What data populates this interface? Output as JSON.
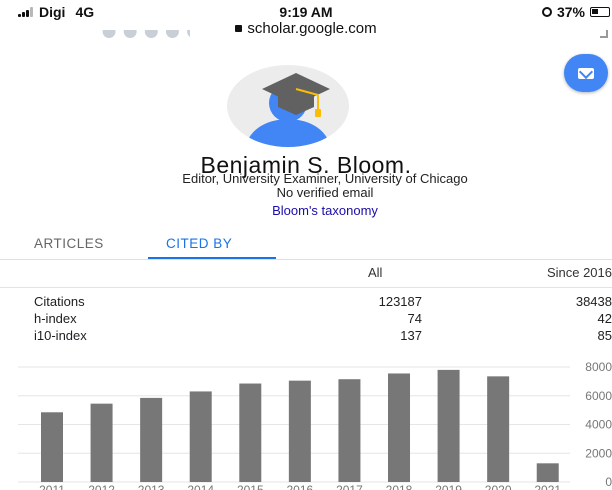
{
  "status_bar": {
    "carrier": "Digi",
    "network": "4G",
    "time": "9:19 AM",
    "url": "scholar.google.com",
    "battery": "37%"
  },
  "profile": {
    "name": "Benjamin S. Bloom.",
    "affiliation": "Editor, University Examiner, University of Chicago",
    "email_status": "No verified email",
    "interest": "Bloom's taxonomy",
    "avatar_icon": "graduation-cap-avatar",
    "mail_button_icon": "envelope-icon",
    "accent_color": "#4285f4"
  },
  "tabs": [
    {
      "label": "ARTICLES",
      "active": false
    },
    {
      "label": "CITED BY",
      "active": true
    }
  ],
  "metrics": {
    "headers": {
      "all": "All",
      "since": "Since 2016"
    },
    "rows": [
      {
        "label": "Citations",
        "all": "123187",
        "since": "38438"
      },
      {
        "label": "h-index",
        "all": "74",
        "since": "42"
      },
      {
        "label": "i10-index",
        "all": "137",
        "since": "85"
      }
    ]
  },
  "chart_data": {
    "type": "bar",
    "categories": [
      "2011",
      "2012",
      "2013",
      "2014",
      "2015",
      "2016",
      "2017",
      "2018",
      "2019",
      "2020",
      "2021"
    ],
    "values": [
      4850,
      5450,
      5850,
      6300,
      6850,
      7050,
      7150,
      7550,
      7800,
      7350,
      1300
    ],
    "ylim": [
      0,
      8000
    ],
    "yticks": [
      "0",
      "2000",
      "4000",
      "6000",
      "8000"
    ],
    "bar_color": "#777777",
    "grid": true
  }
}
